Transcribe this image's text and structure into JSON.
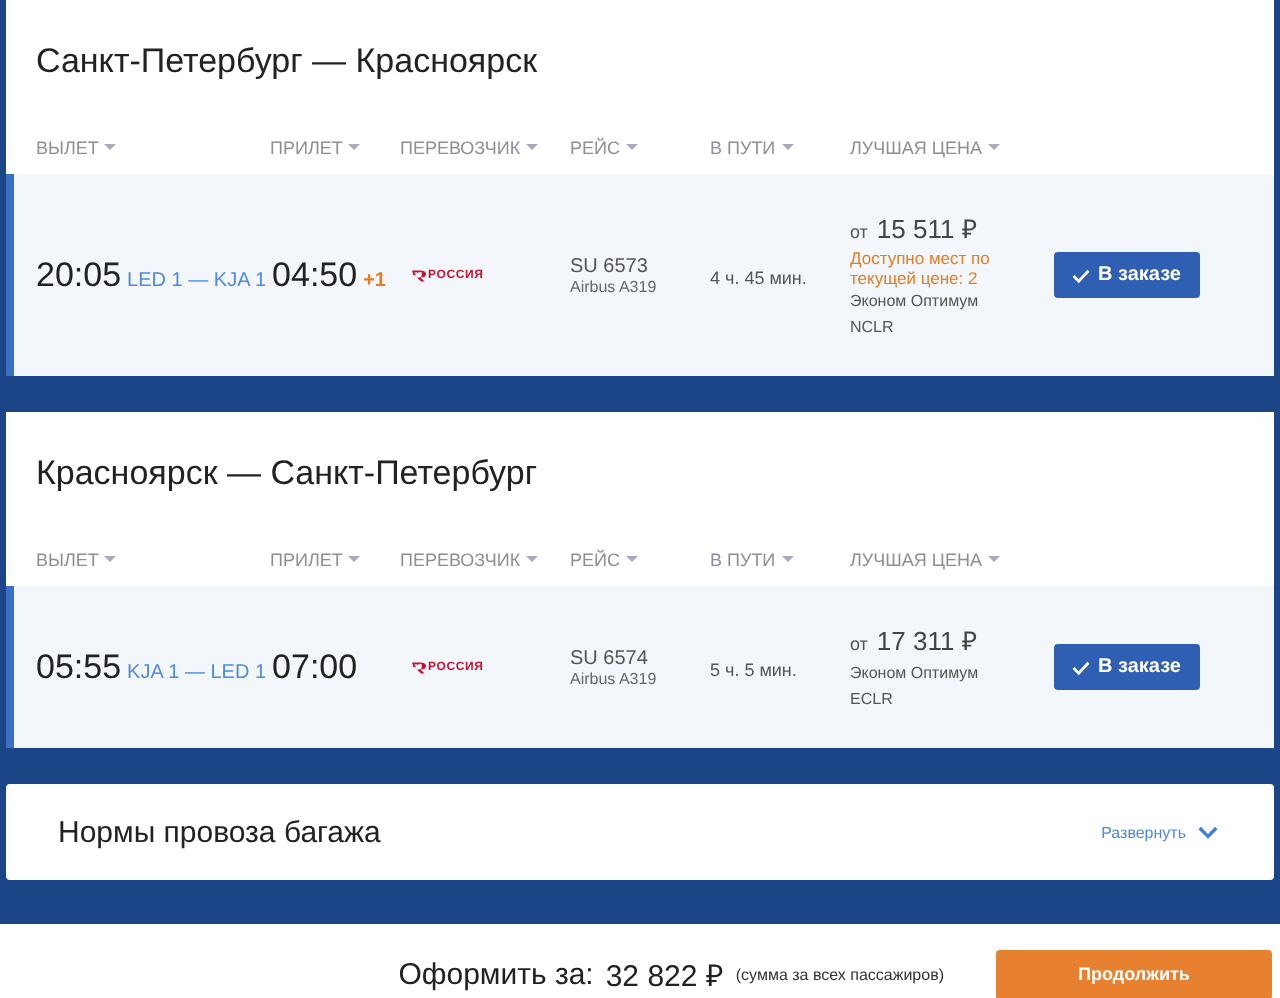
{
  "segments": [
    {
      "title": "Санкт-Петербург — Красноярск",
      "columns": [
        "ВЫЛЕТ",
        "ПРИЛЕТ",
        "ПЕРЕВОЗЧИК",
        "РЕЙС",
        "В ПУТИ",
        "ЛУЧШАЯ ЦЕНА"
      ],
      "flight": {
        "departure": "20:05",
        "route": "LED 1 — KJA 1",
        "arrival": "04:50",
        "day_offset": "+1",
        "carrier": "РОССИЯ",
        "number": "SU 6573",
        "aircraft": "Airbus A319",
        "duration": "4 ч. 45 мин.",
        "price_prefix": "от",
        "price": "15 511 ₽",
        "availability": "Доступно мест по текущей цене: 2",
        "fare": "Эконом Оптимум",
        "fare_code": "NCLR",
        "button": "В заказе",
        "selected": true
      }
    },
    {
      "title": "Красноярск — Санкт-Петербург",
      "columns": [
        "ВЫЛЕТ",
        "ПРИЛЕТ",
        "ПЕРЕВОЗЧИК",
        "РЕЙС",
        "В ПУТИ",
        "ЛУЧШАЯ ЦЕНА"
      ],
      "flight": {
        "departure": "05:55",
        "route": "KJA 1 — LED 1",
        "arrival": "07:00",
        "carrier": "РОССИЯ",
        "number": "SU 6574",
        "aircraft": "Airbus A319",
        "duration": "5 ч. 5 мин.",
        "price_prefix": "от",
        "price": "17 311 ₽",
        "fare": "Эконом Оптимум",
        "fare_code": "ECLR",
        "button": "В заказе",
        "selected": true
      }
    }
  ],
  "baggage": {
    "title": "Нормы провоза багажа",
    "toggle": "Развернуть",
    "expanded": false
  },
  "footer": {
    "label": "Оформить за:",
    "total": "32 822 ₽",
    "note": "(сумма за всех пассажиров)",
    "button": "Продолжить"
  }
}
